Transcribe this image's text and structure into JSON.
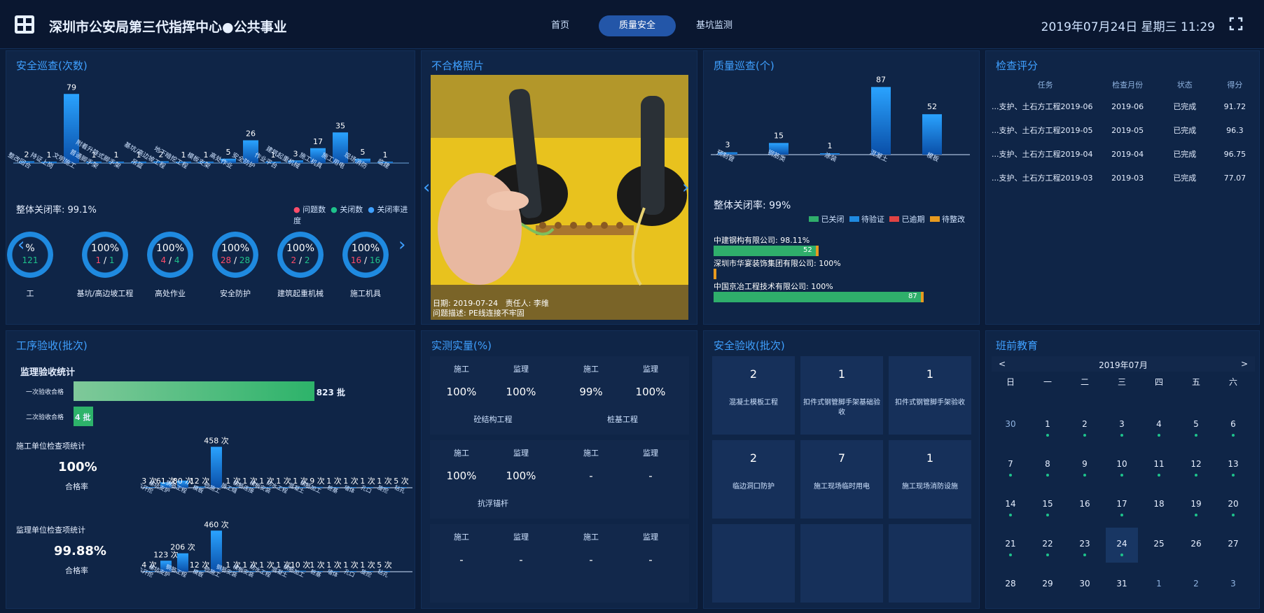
{
  "header": {
    "title": "深圳市公安局第三代指挥中心●公共事业",
    "tabs": [
      {
        "label": "首页"
      },
      {
        "label": "质量安全"
      },
      {
        "label": "基坑监测"
      }
    ],
    "datetime": "2019年07月24日 星期三 11:29",
    "logo_icon": "building-logo-icon",
    "fullscreen_icon": "fullscreen-icon"
  },
  "safety_patrol": {
    "title": "安全巡查(次数)",
    "close_rate": "整体关闭率: 99.1%",
    "legend": [
      "问题数",
      "关闭数",
      "关闭率进度"
    ],
    "chart_data": {
      "type": "bar",
      "categories": [
        "整改回合",
        "持证上岗",
        "文明施工",
        "普通脚手架",
        "附着升降式脚手架",
        "吊篮",
        "基坑/高边坡工程",
        "地下暗挖工程",
        "模板支架",
        "高处作业",
        "安全防护",
        "作业平台",
        "建筑起重机械",
        "施工机具",
        "施工用电",
        "现场消防",
        "临建"
      ],
      "values": [
        2,
        1,
        79,
        1,
        1,
        1,
        2,
        1,
        1,
        5,
        26,
        1,
        3,
        17,
        35,
        5,
        1
      ]
    },
    "gauges": [
      {
        "pct": "%",
        "count_a": "",
        "count_b": "121",
        "name": "工"
      },
      {
        "pct": "100%",
        "count_a": "1",
        "count_b": "1",
        "name": "基坑/高边坡工程"
      },
      {
        "pct": "100%",
        "count_a": "4",
        "count_b": "4",
        "name": "高处作业"
      },
      {
        "pct": "100%",
        "count_a": "28",
        "count_b": "28",
        "name": "安全防护"
      },
      {
        "pct": "100%",
        "count_a": "2",
        "count_b": "2",
        "name": "建筑起重机械"
      },
      {
        "pct": "100%",
        "count_a": "16",
        "count_b": "16",
        "name": "施工机具"
      }
    ]
  },
  "photo": {
    "title": "不合格照片",
    "date": "日期: 2019-07-24",
    "person": "责任人: 李维",
    "desc": "问题描述: PE线连接不牢固"
  },
  "quality_patrol": {
    "title": "质量巡查(个)",
    "close_rate": "整体关闭率: 99%",
    "legend": [
      "已关闭",
      "待验证",
      "已逾期",
      "待整改"
    ],
    "chart_data": {
      "type": "bar",
      "categories": [
        "预制管",
        "钢筋类",
        "涂装",
        "混凝土",
        "模板"
      ],
      "values": [
        3,
        15,
        1,
        87,
        52
      ]
    },
    "companies": [
      {
        "name": "中建钢构有限公司: 98.11%",
        "value": 52,
        "fill": 0.5
      },
      {
        "name": "深圳市华宴装饰集团有限公司: 100%",
        "value": 1,
        "fill": 0.01
      },
      {
        "name": "中国京冶工程技术有限公司: 100%",
        "value": 87,
        "fill": 1.0
      }
    ]
  },
  "score": {
    "title": "检查评分",
    "headers": [
      "任务",
      "检查月份",
      "状态",
      "得分"
    ],
    "rows": [
      [
        "...支护、土石方工程2019-06",
        "2019-06",
        "已完成",
        "91.72"
      ],
      [
        "...支护、土石方工程2019-05",
        "2019-05",
        "已完成",
        "96.3"
      ],
      [
        "...支护、土石方工程2019-04",
        "2019-04",
        "已完成",
        "96.75"
      ],
      [
        "...支护、土石方工程2019-03",
        "2019-03",
        "已完成",
        "77.07"
      ]
    ]
  },
  "process": {
    "title": "工序验收(批次)",
    "sub": "监理验收统计",
    "first_label": "一次验收合格",
    "first_value": "823 批",
    "first_fill": 1.0,
    "second_label": "二次验收合格",
    "second_value": "4 批",
    "second_fill": 0.005,
    "unit_title": "施工单位检查项统计",
    "unit_pct": "100%",
    "unit_caption": "合格率",
    "sup_title": "监理单位检查项统计",
    "sup_pct": "99.88%",
    "sup_caption": "合格率",
    "chart_data": [
      {
        "type": "bar",
        "values": [
          3,
          61,
          80,
          12,
          458,
          1,
          1,
          1,
          1,
          1,
          9,
          1,
          1,
          1,
          1,
          5
        ],
        "labels": [
          "3 次",
          "61 次",
          "80 次",
          "12 次",
          "458 次",
          "1 次",
          "1 次",
          "1 次",
          "1 次",
          "1 次",
          "9 次",
          "1 次",
          "1 次",
          "1 次",
          "1 次",
          "5 次"
        ],
        "categories": [
          "土方开挖",
          "基坑支护",
          "钢筋工程",
          "模板",
          "砼施工",
          "施工缝",
          "钢筋连接",
          "模板安装",
          "防水工程",
          "混凝土",
          "钢筋加工",
          "桩基",
          "墙体",
          "孔口",
          "旋挖",
          "钻孔"
        ]
      },
      {
        "type": "bar",
        "values": [
          4,
          123,
          206,
          12,
          460,
          1,
          1,
          1,
          1,
          10,
          1,
          1,
          1,
          1,
          5
        ],
        "labels": [
          "4 次",
          "123 次",
          "206 次",
          "12 次",
          "460 次",
          "1 次",
          "1 次",
          "1 次",
          "1 次",
          "10 次",
          "1 次",
          "1 次",
          "1 次",
          "1 次",
          "5 次"
        ],
        "categories": [
          "土方开挖",
          "基坑支护",
          "钢筋工程",
          "模板",
          "砼施工",
          "钢筋安装",
          "模板安装",
          "防水工程",
          "混凝土",
          "钢筋加工",
          "桩基",
          "墙体",
          "孔口",
          "旋挖",
          "钻孔"
        ]
      }
    ]
  },
  "measure": {
    "title": "实测实量(%)",
    "cols": [
      "施工",
      "监理"
    ],
    "tiles": [
      {
        "a": "100%",
        "b": "100%",
        "name": "砼结构工程"
      },
      {
        "a": "99%",
        "b": "100%",
        "name": "桩基工程"
      },
      {
        "a": "100%",
        "b": "100%",
        "name": "抗浮锚杆"
      },
      {
        "a": "-",
        "b": "-",
        "name": ""
      },
      {
        "a": "-",
        "b": "-",
        "name": ""
      },
      {
        "a": "-",
        "b": "-",
        "name": ""
      }
    ]
  },
  "safety_accept": {
    "title": "安全验收(批次)",
    "tiles": [
      {
        "value": "2",
        "name": "混凝土模板工程"
      },
      {
        "value": "1",
        "name": "扣件式钢管脚手架基础验收"
      },
      {
        "value": "1",
        "name": "扣件式钢管脚手架验收"
      },
      {
        "value": "2",
        "name": "临边洞口防护"
      },
      {
        "value": "7",
        "name": "施工现场临时用电"
      },
      {
        "value": "1",
        "name": "施工现场消防设施"
      },
      {
        "value": "",
        "name": ""
      },
      {
        "value": "",
        "name": ""
      },
      {
        "value": "",
        "name": ""
      }
    ]
  },
  "education": {
    "title": "班前教育",
    "month": "2019年07月",
    "prev": "<",
    "next": ">",
    "weekdays": [
      "日",
      "一",
      "二",
      "三",
      "四",
      "五",
      "六"
    ],
    "weeks": [
      [
        "30",
        "1",
        "2",
        "3",
        "4",
        "5",
        "6"
      ],
      [
        "7",
        "8",
        "9",
        "10",
        "11",
        "12",
        "13"
      ],
      [
        "14",
        "15",
        "16",
        "17",
        "18",
        "19",
        "20"
      ],
      [
        "21",
        "22",
        "23",
        "24",
        "25",
        "26",
        "27"
      ],
      [
        "28",
        "29",
        "30",
        "31",
        "1",
        "2",
        "3"
      ]
    ]
  }
}
